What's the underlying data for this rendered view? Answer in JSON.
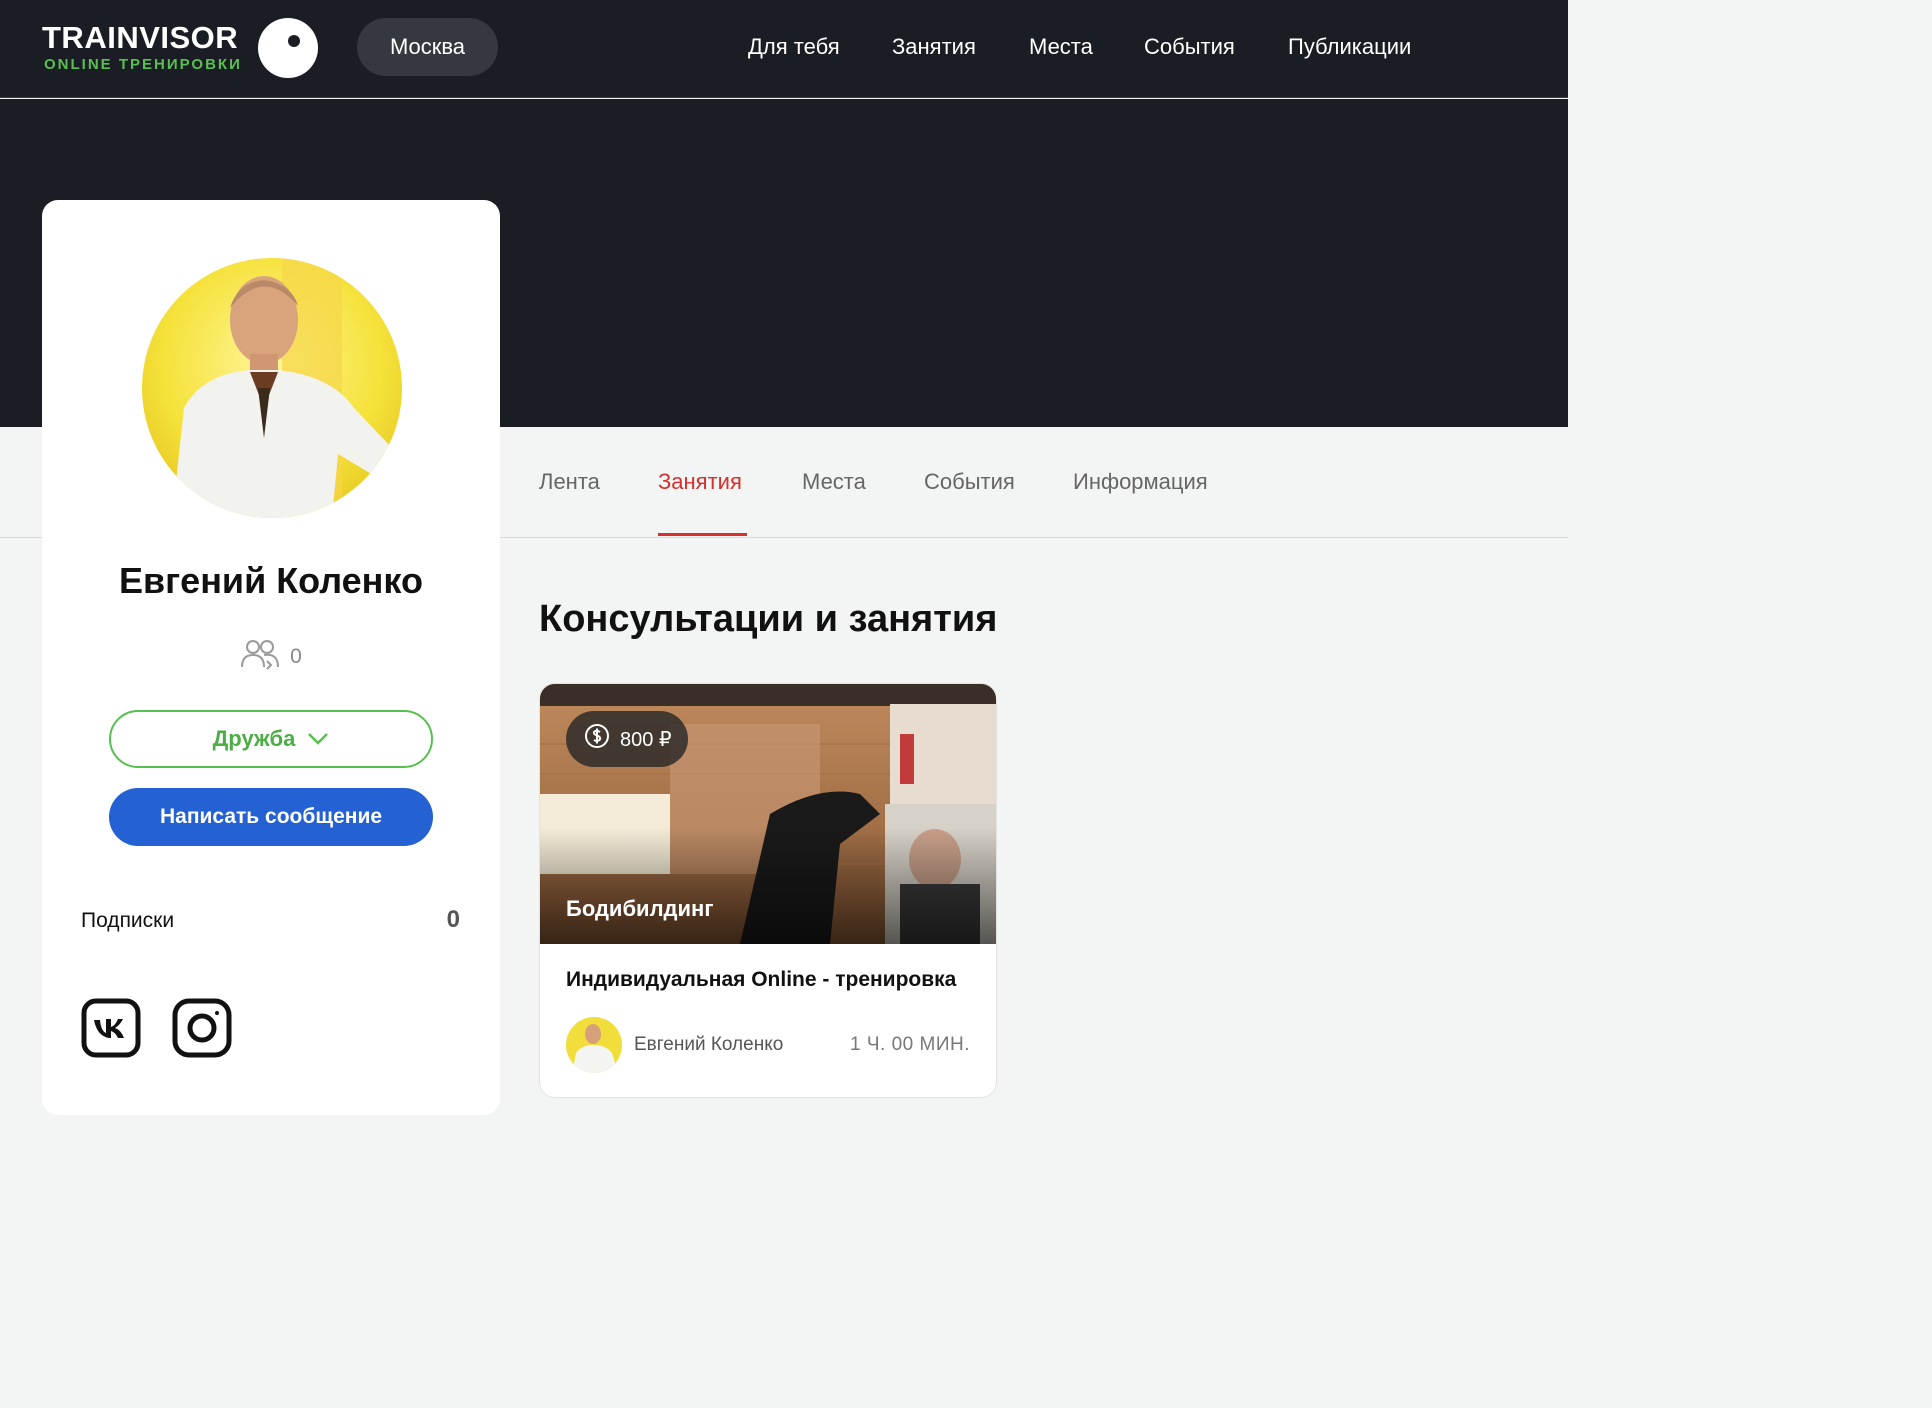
{
  "header": {
    "logo_title": "TRAINVISOR",
    "logo_subtitle": "ONLINE ТРЕНИРОВКИ",
    "city": "Москва",
    "nav": [
      "Для тебя",
      "Занятия",
      "Места",
      "События",
      "Публикации"
    ]
  },
  "profile": {
    "name": "Евгений Коленко",
    "friends_count": "0",
    "friend_button": "Дружба",
    "message_button": "Написать сообщение",
    "subscriptions_label": "Подписки",
    "subscriptions_count": "0",
    "social": [
      "vk-icon",
      "instagram-icon"
    ]
  },
  "tabs": {
    "items": [
      "Лента",
      "Занятия",
      "Места",
      "События",
      "Информация"
    ],
    "active": "Занятия"
  },
  "section": {
    "title": "Консультации и занятия"
  },
  "class_card": {
    "price": "800 ₽",
    "sport": "Бодибилдинг",
    "title": "Индивидуальная Online - тренировка",
    "trainer": "Евгений Коленко",
    "duration": "1 Ч. 00 МИН."
  },
  "colors": {
    "header_bg": "#1b1d24",
    "accent_green": "#58c050",
    "accent_blue": "#2461d2",
    "accent_red": "#d6302c"
  }
}
